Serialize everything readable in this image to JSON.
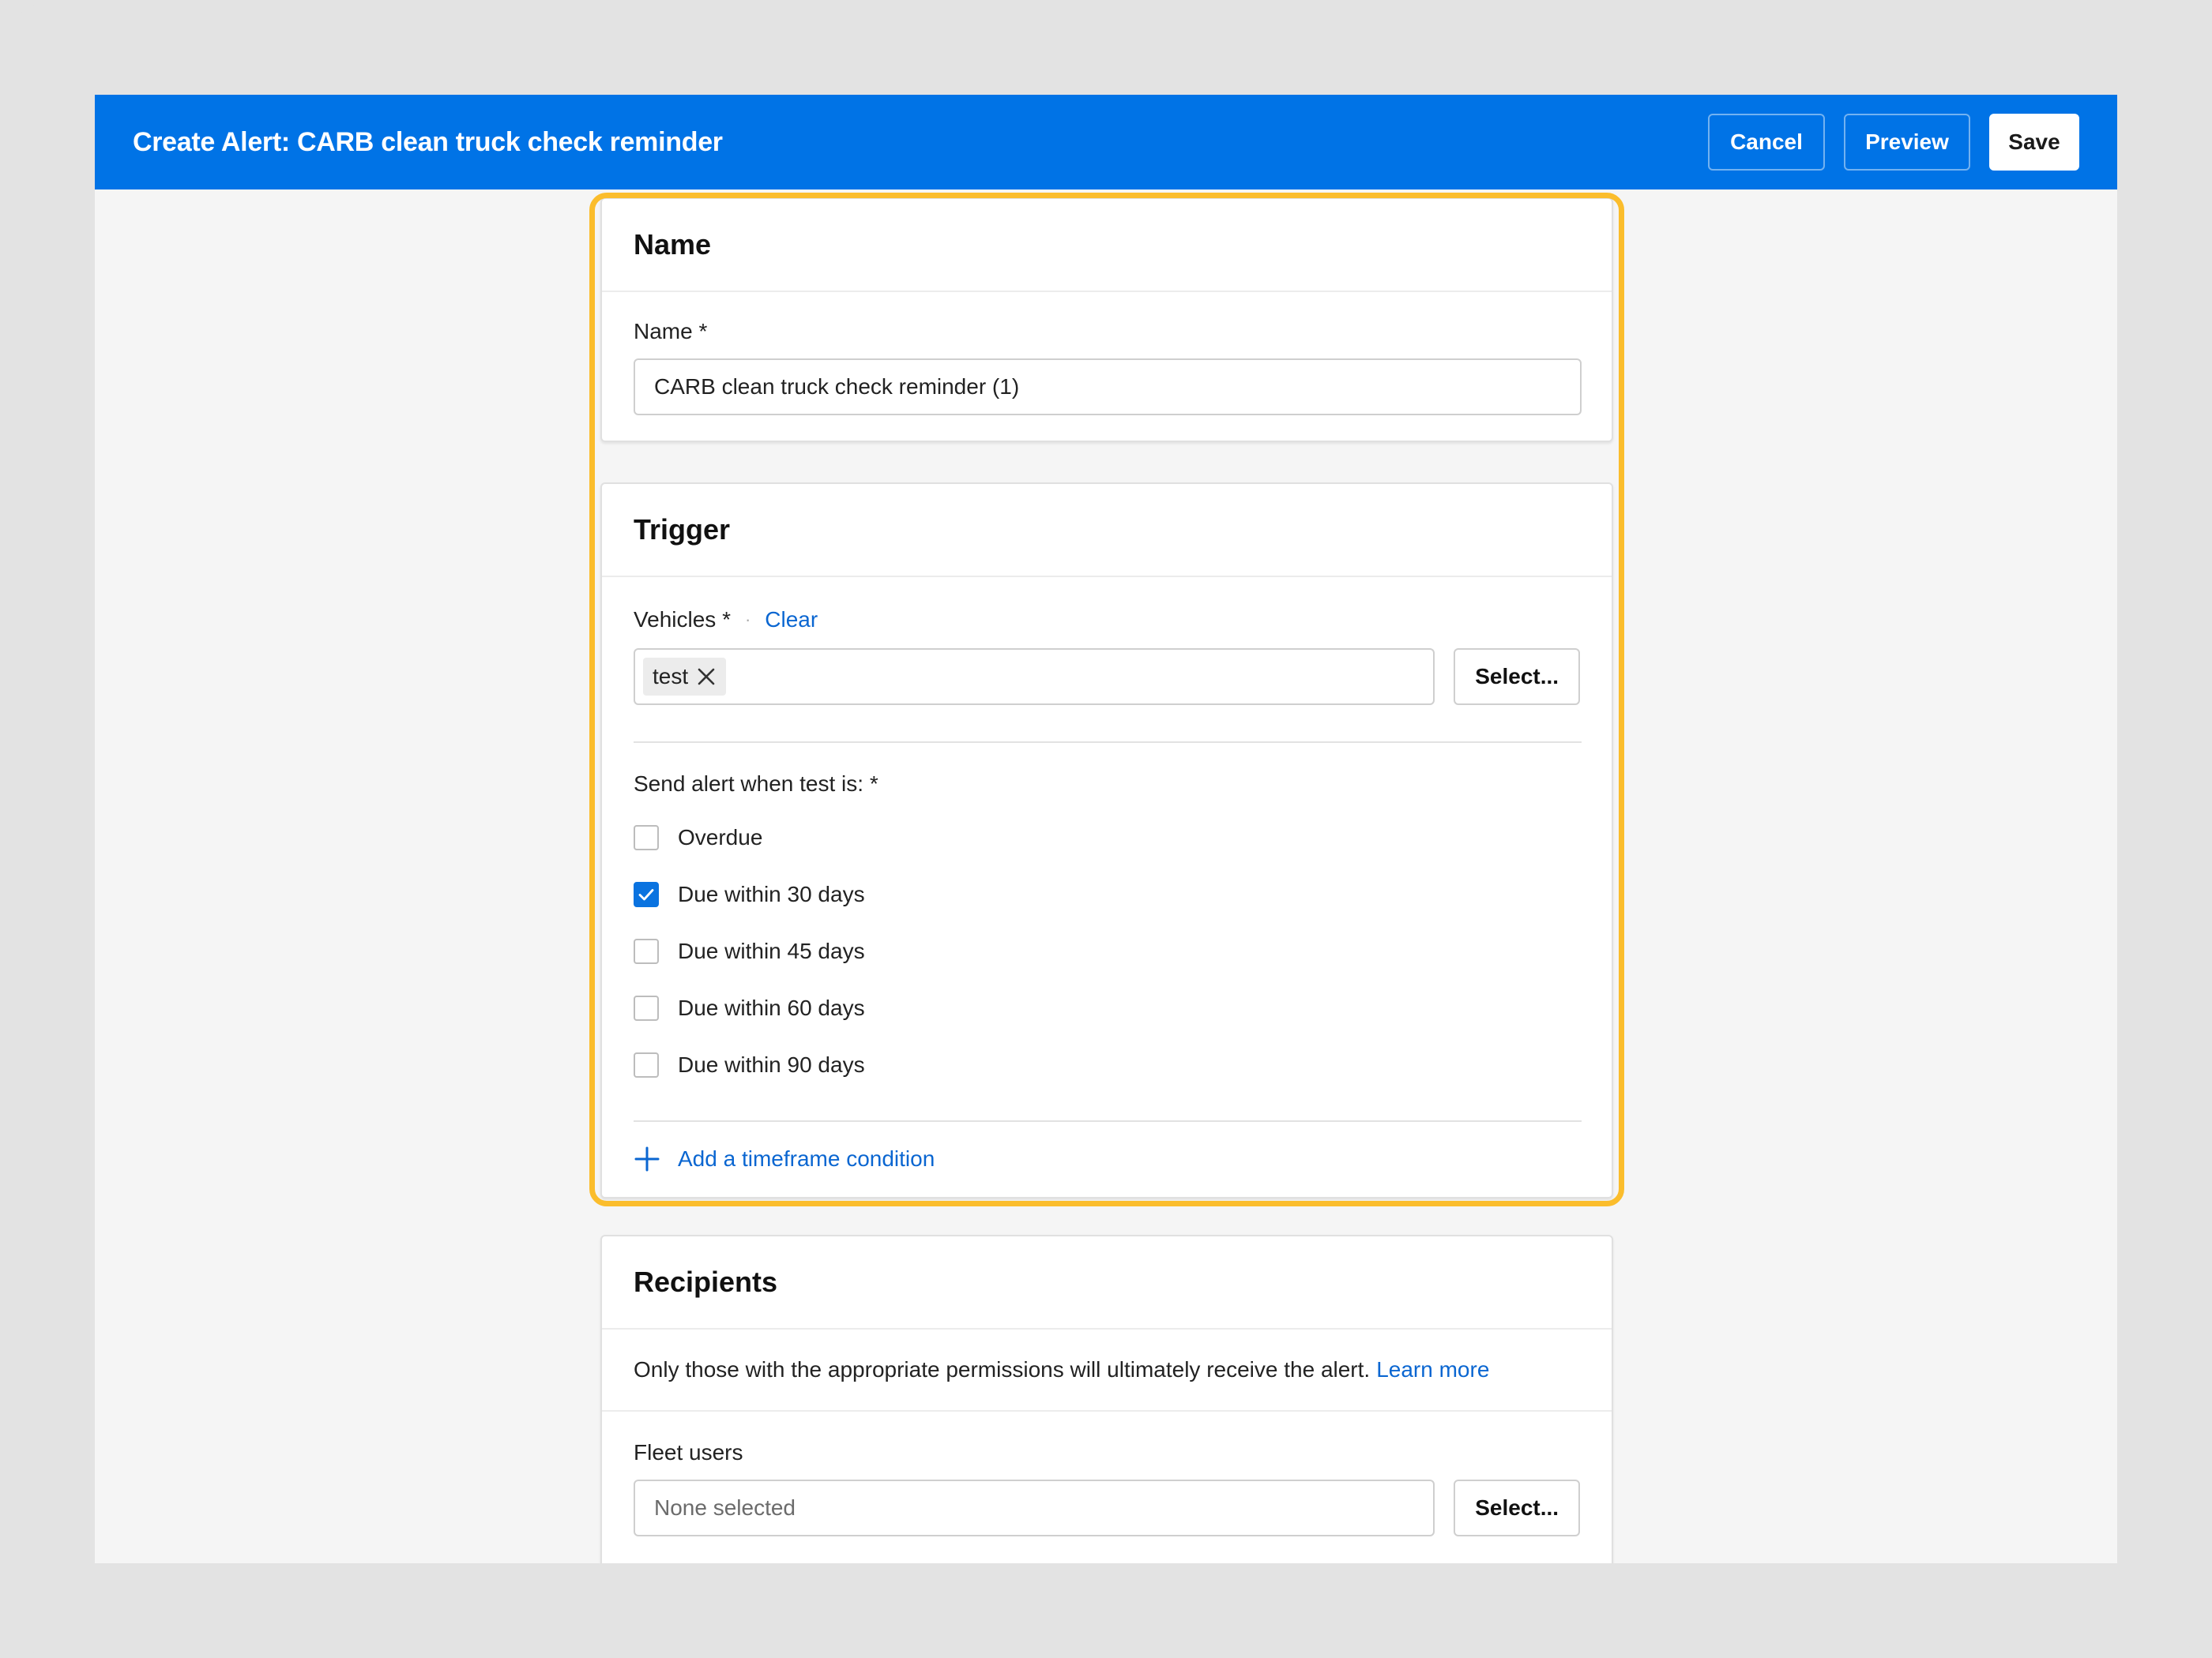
{
  "header": {
    "title": "Create Alert: CARB clean truck check reminder",
    "cancel_label": "Cancel",
    "preview_label": "Preview",
    "save_label": "Save",
    "bg_color": "#0073e6"
  },
  "name_section": {
    "title": "Name",
    "field_label": "Name *",
    "value": "CARB clean truck check reminder (1)"
  },
  "trigger_section": {
    "title": "Trigger",
    "vehicles_label": "Vehicles *",
    "separator": "·",
    "clear_label": "Clear",
    "selected_vehicles": [
      "test"
    ],
    "select_label": "Select...",
    "send_alert_label": "Send alert when test is: *",
    "options": [
      {
        "label": "Overdue",
        "checked": false
      },
      {
        "label": "Due within 30 days",
        "checked": true
      },
      {
        "label": "Due within 45 days",
        "checked": false
      },
      {
        "label": "Due within 60 days",
        "checked": false
      },
      {
        "label": "Due within 90 days",
        "checked": false
      }
    ],
    "add_condition_label": "Add a timeframe condition"
  },
  "recipients_section": {
    "title": "Recipients",
    "info_text": "Only those with the appropriate permissions will ultimately receive the alert.",
    "learn_more_label": "Learn more",
    "fleet_users_label": "Fleet users",
    "fleet_users_placeholder": "None selected",
    "select_label": "Select..."
  },
  "colors": {
    "accent": "#0a73e0",
    "link": "#0a66d1",
    "highlight": "#fbbd2c"
  }
}
